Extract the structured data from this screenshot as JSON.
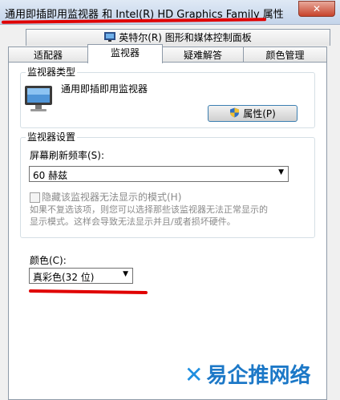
{
  "window": {
    "title": "通用即插即用监视器 和 Intel(R) HD Graphics Family 属性",
    "close_glyph": "✕"
  },
  "tabs": {
    "top": {
      "label": "英特尔(R) 图形和媒体控制面板",
      "icon": "intel-graphics-icon"
    },
    "row": [
      {
        "label": "适配器"
      },
      {
        "label": "监视器",
        "active": true
      },
      {
        "label": "疑难解答"
      },
      {
        "label": "颜色管理"
      }
    ]
  },
  "monitor_type": {
    "legend": "监视器类型",
    "name": "通用即插即用监视器",
    "icon": "monitor-icon",
    "properties_button": "属性(P)",
    "properties_icon": "uac-shield-icon"
  },
  "monitor_settings": {
    "legend": "监视器设置",
    "refresh_label": "屏幕刷新频率(S):",
    "refresh_value": "60 赫兹",
    "hide_modes_label": "隐藏该监视器无法显示的模式(H)",
    "hide_modes_checked": false,
    "description_line1": "如果不复选该项，则您可以选择那些该监视器无法正常显示的",
    "description_line2": "显示模式。这样会导致无法显示并且/或者损坏硬件。"
  },
  "colors": {
    "label": "颜色(C):",
    "value": "真彩色(32 位)"
  },
  "watermark": {
    "text": "易企推网络",
    "accent": "#1c78c7"
  }
}
